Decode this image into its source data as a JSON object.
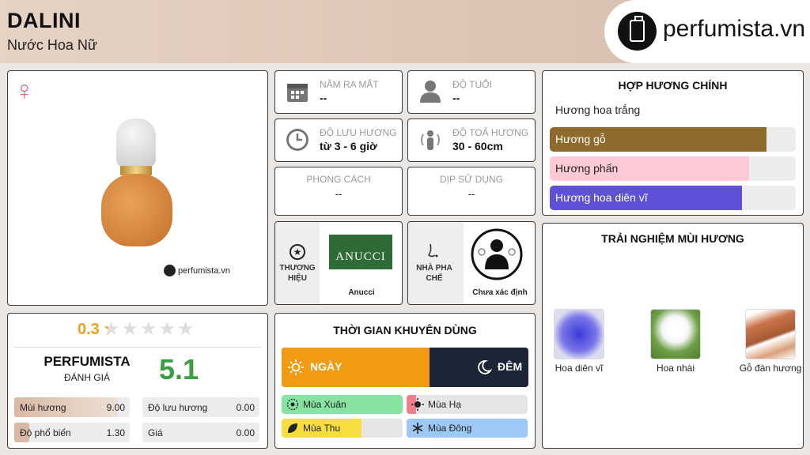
{
  "header": {
    "title": "DALINI",
    "subtitle": "Nước Hoa Nữ",
    "logo_text": "perfumista.vn"
  },
  "product": {
    "gender_icon": "female-symbol-icon",
    "watermark": "perfumista.vn"
  },
  "info": {
    "release_label": "NĂM RA MẮT",
    "release_value": "--",
    "age_label": "ĐỘ TUỔI",
    "age_value": "--",
    "longevity_label": "ĐỘ LƯU HƯƠNG",
    "longevity_value": "từ 3 - 6 giờ",
    "sillage_label": "ĐỘ TOẢ HƯƠNG",
    "sillage_value": "30 - 60cm",
    "style_label": "PHONG CÁCH",
    "style_value": "--",
    "occasion_label": "DỊP SỬ DỤNG",
    "occasion_value": "--"
  },
  "brand": {
    "label": "THƯƠNG HIỆU",
    "logo_text": "ANUCCI",
    "name": "Anucci"
  },
  "perfumer": {
    "label": "NHÀ PHA CHẾ",
    "name": "Chưa xác định"
  },
  "accords": {
    "title": "HỢP HƯƠNG CHÍNH",
    "items": [
      {
        "label": "Hương hoa trắng",
        "level": 1.0,
        "color": "#ffffff",
        "text_color": "#222222"
      },
      {
        "label": "Hương gỗ",
        "level": 0.88,
        "color": "#8f6a2d",
        "text_color": "#ffffff"
      },
      {
        "label": "Hương phấn",
        "level": 0.81,
        "color": "#ffc9d6",
        "text_color": "#222222"
      },
      {
        "label": "Hương hoa diên vĩ",
        "level": 0.78,
        "color": "#5e51d8",
        "text_color": "#ffffff"
      }
    ]
  },
  "experience": {
    "title": "TRẢI NGHIỆM MÙI HƯƠNG",
    "notes": [
      {
        "label": "Hoa diên vĩ",
        "icon": "iris-flower-icon"
      },
      {
        "label": "Hoa nhài",
        "icon": "jasmine-flower-icon"
      },
      {
        "label": "Gỗ đàn hương",
        "icon": "sandalwood-icon"
      }
    ]
  },
  "rating": {
    "score": "0.3",
    "stars_value": 0.3,
    "stars_max": 5,
    "brand_label": "PERFUMISTA",
    "eval_label": "ĐÁNH GIÁ",
    "perfumista_score": "5.1",
    "rows": [
      {
        "label": "Mùi hương",
        "value": "9.00",
        "level": 0.9
      },
      {
        "label": "Độ lưu hương",
        "value": "0.00",
        "level": 0.0
      },
      {
        "label": "Độ phổ biến",
        "value": "1.30",
        "level": 0.13
      },
      {
        "label": "Giá",
        "value": "0.00",
        "level": 0.0
      }
    ]
  },
  "time": {
    "title": "THỜI GIAN KHUYÊN DÙNG",
    "day_label": "NGÀY",
    "night_label": "ĐÊM",
    "day_fraction": 0.6,
    "day_color": "#f29a12",
    "night_color": "#1c2535",
    "seasons": [
      {
        "label": "Mùa Xuân",
        "level": 1.0,
        "color": "#86e3a1",
        "icon": "spring-flower-icon"
      },
      {
        "label": "Mùa Hạ",
        "level": 0.08,
        "color": "#f07e8b",
        "icon": "sun-icon"
      },
      {
        "label": "Mùa Thu",
        "level": 0.66,
        "color": "#f7dd3e",
        "icon": "leaf-icon"
      },
      {
        "label": "Mùa Đông",
        "level": 1.0,
        "color": "#9ec9f6",
        "icon": "snowflake-icon"
      }
    ]
  }
}
